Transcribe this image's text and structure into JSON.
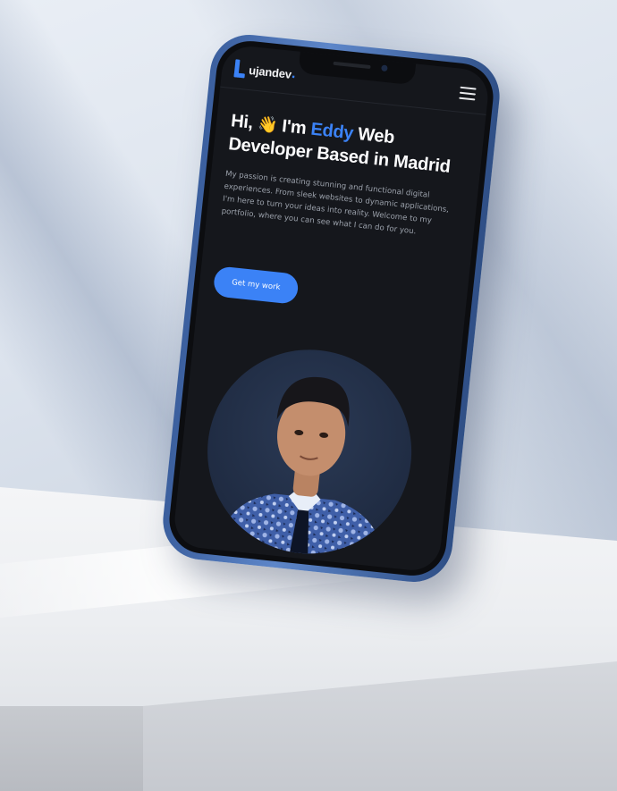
{
  "nav": {
    "logo_text": "ujandev",
    "logo_dot": "."
  },
  "hero": {
    "greeting": "Hi,",
    "wave_icon": "👋",
    "im": "I'm",
    "name": "Eddy",
    "role_line_1": "Web",
    "role_line_2": "Developer Based in Madrid",
    "description": "My passion is creating stunning and functional digital experiences. From sleek websites to dynamic applications, I'm here to turn your ideas into reality. Welcome to my portfolio, where you can see what I can do for you.",
    "cta_label": "Get my work"
  },
  "colors": {
    "accent": "#3b82f6",
    "screen_bg": "#15171c",
    "text": "#fbfbfc",
    "muted": "#9aa0aa"
  },
  "icons": {
    "menu": "hamburger-menu-icon",
    "logo": "logo-mark-icon",
    "wave": "waving-hand-icon"
  }
}
